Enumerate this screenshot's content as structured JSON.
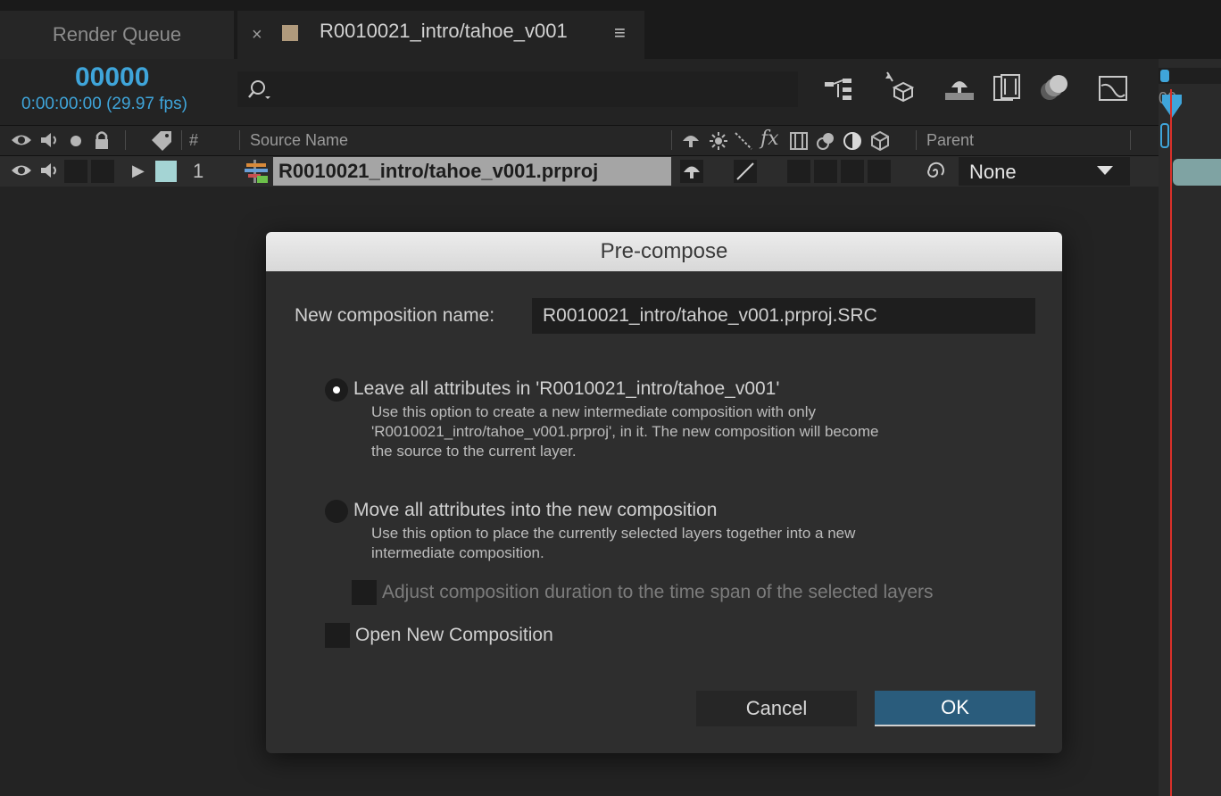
{
  "tabs": {
    "render_queue": "Render Queue",
    "close": "×",
    "comp": "R0010021_intro/tahoe_v001",
    "menu": "≡"
  },
  "header": {
    "timecode": "00000",
    "fps_line": "0:00:00:00 (29.97 fps)"
  },
  "timeline": {
    "ruler_label": "00"
  },
  "columns": {
    "number": "#",
    "source_name": "Source Name",
    "fx": "fx",
    "parent": "Parent"
  },
  "layer": {
    "expand": "▶",
    "index": "1",
    "name": "R0010021_intro/tahoe_v001.prproj",
    "parent_value": "None",
    "label_color": "#a4d4d4"
  },
  "dialog": {
    "title": "Pre-compose",
    "name_label": "New composition name:",
    "name_value": "R0010021_intro/tahoe_v001.prproj.SRC",
    "option1": {
      "label": "Leave all attributes in 'R0010021_intro/tahoe_v001'",
      "desc_lines": [
        "Use this option to create a new intermediate composition with only",
        "'R0010021_intro/tahoe_v001.prproj', in it. The new composition will become",
        "the source to the current layer."
      ],
      "selected": true
    },
    "option2": {
      "label": "Move all attributes into the new composition",
      "desc_lines": [
        "Use this option to place the currently selected layers together into a new",
        "intermediate composition."
      ],
      "selected": false
    },
    "adjust_duration_label": "Adjust composition duration to the time span of the selected layers",
    "open_new_label": "Open New Composition",
    "cancel": "Cancel",
    "ok": "OK"
  },
  "colors": {
    "accent": "#3fa5da",
    "ok_button": "#2a5c7c",
    "playhead": "#d9302a"
  }
}
